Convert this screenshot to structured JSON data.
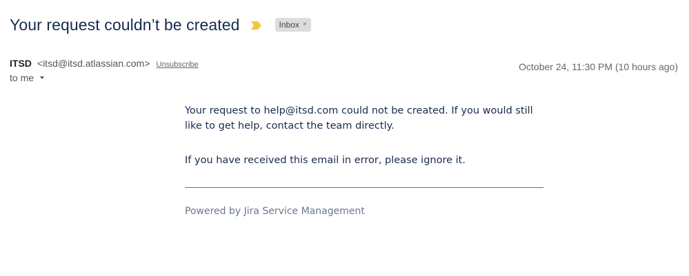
{
  "email": {
    "subject": "Your request couldn’t be created",
    "label": "Inbox",
    "label_remove_glyph": "×",
    "importance_color": "#f5c542",
    "sender": {
      "name": "ITSD",
      "email": "<itsd@itsd.atlassian.com>",
      "unsubscribe": "Unsubscribe"
    },
    "recipient": "to me",
    "date": "October 24, 11:30 PM (10 hours ago)",
    "body": {
      "paragraph1": "Your request to help@itsd.com could not be created. If you would still like to get help, contact the team directly.",
      "paragraph2": "If you have received this email in error, please ignore it.",
      "footer": "Powered by Jira Service Management"
    }
  }
}
